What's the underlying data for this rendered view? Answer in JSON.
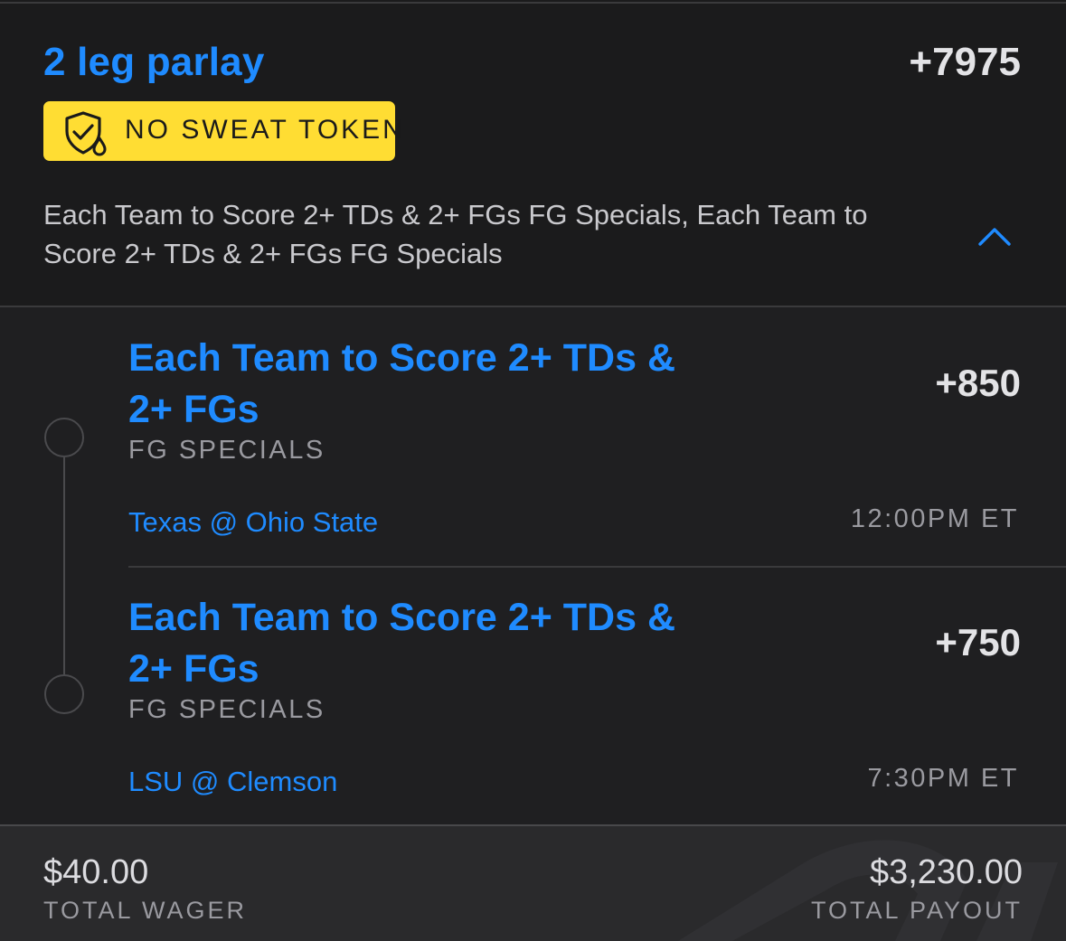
{
  "header": {
    "title": "2 leg parlay",
    "odds": "+7975",
    "token": {
      "label": "NO SWEAT TOKEN",
      "icon": "shield-check-drop-icon",
      "background_color": "#ffdd33"
    },
    "description": "Each Team to Score 2+ TDs & 2+ FGs FG Specials, Each Team to Score 2+ TDs & 2+ FGs FG Specials",
    "toggle_icon": "chevron-up-icon"
  },
  "legs": [
    {
      "name": "Each Team to Score 2+ TDs & 2+ FGs",
      "market": "FG SPECIALS",
      "odds": "+850",
      "event": "Texas @ Ohio State",
      "time": "12:00PM ET"
    },
    {
      "name": "Each Team to Score 2+ TDs & 2+ FGs",
      "market": "FG SPECIALS",
      "odds": "+750",
      "event": "LSU @ Clemson",
      "time": "7:30PM ET"
    }
  ],
  "footer": {
    "wager_amount": "$40.00",
    "wager_label": "TOTAL WAGER",
    "payout_amount": "$3,230.00",
    "payout_label": "TOTAL PAYOUT"
  },
  "colors": {
    "accent": "#1f8bff",
    "background": "#1b1b1c",
    "token_yellow": "#ffdd33"
  }
}
